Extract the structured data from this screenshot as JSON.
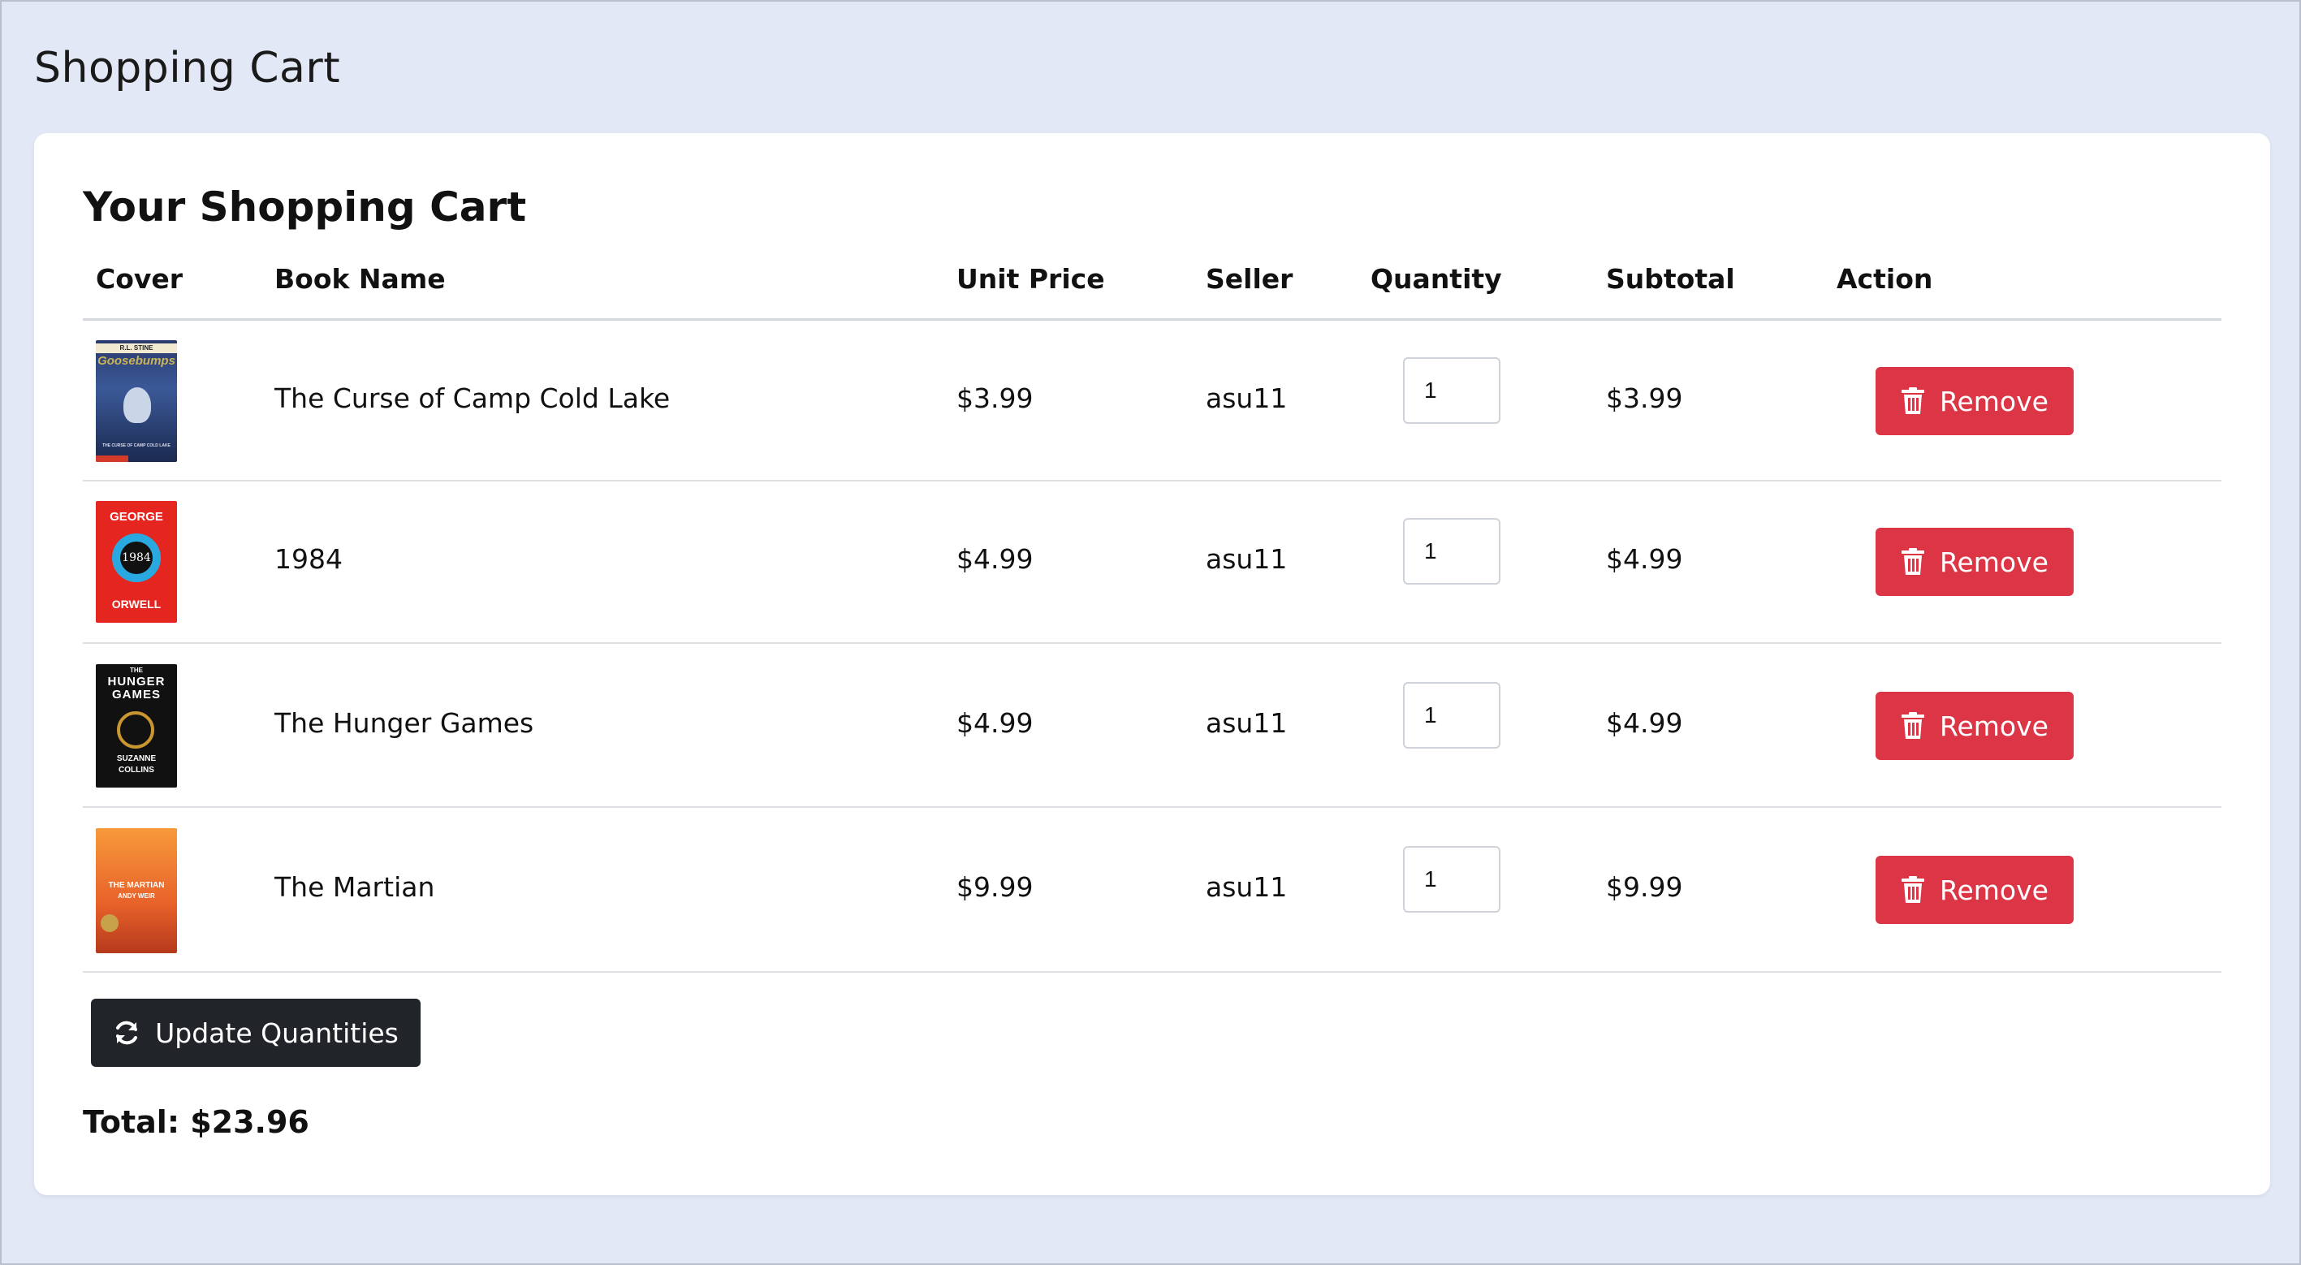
{
  "page": {
    "title": "Shopping Cart"
  },
  "cart": {
    "heading": "Your Shopping Cart",
    "columns": {
      "cover": "Cover",
      "book_name": "Book Name",
      "unit_price": "Unit Price",
      "seller": "Seller",
      "quantity": "Quantity",
      "subtotal": "Subtotal",
      "action": "Action"
    },
    "items": [
      {
        "name": "The Curse of Camp Cold Lake",
        "unit_price": "$3.99",
        "seller": "asu11",
        "quantity": "1",
        "subtotal": "$3.99",
        "action_label": "Remove",
        "cover": {
          "top": "R.L. STINE",
          "series": "Goosebumps",
          "bottom": "THE CURSE OF CAMP COLD LAKE"
        }
      },
      {
        "name": "1984",
        "unit_price": "$4.99",
        "seller": "asu11",
        "quantity": "1",
        "subtotal": "$4.99",
        "action_label": "Remove",
        "cover": {
          "author_first": "GEORGE",
          "title": "1984",
          "author_last": "ORWELL"
        }
      },
      {
        "name": "The Hunger Games",
        "unit_price": "$4.99",
        "seller": "asu11",
        "quantity": "1",
        "subtotal": "$4.99",
        "action_label": "Remove",
        "cover": {
          "title_a": "THE",
          "title_b": "HUNGER",
          "title_c": "GAMES",
          "author_a": "SUZANNE",
          "author_b": "COLLINS"
        }
      },
      {
        "name": "The Martian",
        "unit_price": "$9.99",
        "seller": "asu11",
        "quantity": "1",
        "subtotal": "$9.99",
        "action_label": "Remove",
        "cover": {
          "title": "THE MARTIAN",
          "author": "ANDY WEIR"
        }
      }
    ],
    "update_label": "Update Quantities",
    "total_label": "Total: $23.96"
  },
  "colors": {
    "background": "#e2e8f6",
    "remove": "#dc3545",
    "update": "#212529"
  },
  "icons": {
    "remove": "trash-icon",
    "update": "sync-icon"
  }
}
